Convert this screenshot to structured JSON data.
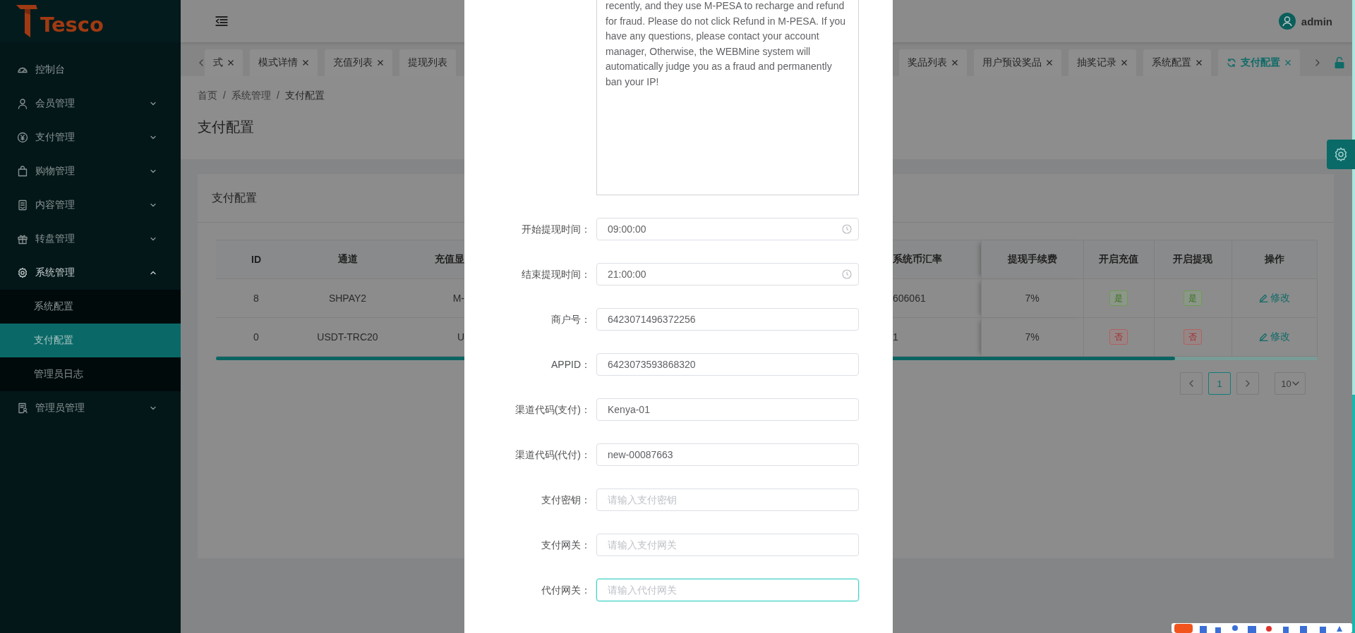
{
  "logo": {
    "text": "Tesco"
  },
  "sidebar": {
    "items": [
      {
        "label": "控制台",
        "kind": "link"
      },
      {
        "label": "会员管理",
        "kind": "menu",
        "expanded": false
      },
      {
        "label": "支付管理",
        "kind": "menu",
        "expanded": false
      },
      {
        "label": "购物管理",
        "kind": "menu",
        "expanded": false
      },
      {
        "label": "内容管理",
        "kind": "menu",
        "expanded": false
      },
      {
        "label": "转盘管理",
        "kind": "menu",
        "expanded": false
      },
      {
        "label": "系统管理",
        "kind": "menu",
        "expanded": true,
        "children": [
          {
            "label": "系统配置",
            "selected": false
          },
          {
            "label": "支付配置",
            "selected": true
          },
          {
            "label": "管理员日志",
            "selected": false
          }
        ]
      },
      {
        "label": "管理员管理",
        "kind": "menu",
        "expanded": false
      }
    ]
  },
  "header": {
    "user": "admin"
  },
  "tabs": {
    "left_items": [
      {
        "label": "式",
        "selected": false,
        "closable": true
      },
      {
        "label": "模式详情",
        "selected": false,
        "closable": true
      },
      {
        "label": "充值列表",
        "selected": false,
        "closable": true
      },
      {
        "label": "提现列表",
        "selected": false,
        "closable": false
      }
    ],
    "right_items": [
      {
        "label": "奖品列表",
        "selected": false,
        "closable": true
      },
      {
        "label": "用户预设奖品",
        "selected": false,
        "closable": true
      },
      {
        "label": "抽奖记录",
        "selected": false,
        "closable": true
      },
      {
        "label": "系统配置",
        "selected": false,
        "closable": true
      },
      {
        "label": "支付配置",
        "selected": true,
        "closable": true
      }
    ]
  },
  "breadcrumb": [
    {
      "label": "首页",
      "separator": "/"
    },
    {
      "label": "系统管理",
      "separator": "/"
    },
    {
      "label": "支付配置"
    }
  ],
  "page_title": "支付配置",
  "card": {
    "title": "支付配置",
    "table": {
      "columns": [
        "ID",
        "通道",
        "充值显",
        "系统币汇率",
        "提现手续费",
        "开启充值",
        "开启提现",
        "操作"
      ],
      "rows": [
        {
          "cells": [
            "8",
            "SHPAY2",
            "M-",
            "606061",
            "7%"
          ],
          "switches": [
            {
              "label": "是",
              "on": true
            },
            {
              "label": "是",
              "on": true
            }
          ],
          "action": "修改"
        },
        {
          "cells": [
            "0",
            "USDT-TRC20",
            "U",
            "1",
            "7%"
          ],
          "switches": [
            {
              "label": "否",
              "on": false
            },
            {
              "label": "否",
              "on": false
            }
          ],
          "action": "修改"
        }
      ]
    },
    "pagination": {
      "pages": [
        {
          "label": "1",
          "selected": true
        }
      ],
      "page_size": "10"
    }
  },
  "dialog": {
    "notice": "recently, and they use M-PESA to recharge and refund for fraud. Please do not click Refund in M-PESA. If you have any questions, please contact your account manager, Otherwise, the WEBMine system will automatically judge you as a fraud and permanently ban your IP!",
    "fields": [
      {
        "label": "开始提现时间：",
        "kind": "time",
        "value": "09:00:00",
        "focused": false
      },
      {
        "label": "结束提现时间：",
        "kind": "time",
        "value": "21:00:00",
        "focused": false
      },
      {
        "label": "商户号：",
        "kind": "text",
        "value": "6423071496372256",
        "focused": false
      },
      {
        "label": "APPID：",
        "kind": "text",
        "value": "6423073593868320",
        "focused": false
      },
      {
        "label": "渠道代码(支付)：",
        "kind": "text",
        "value": "Kenya-01",
        "focused": false
      },
      {
        "label": "渠道代码(代付)：",
        "kind": "text",
        "value": "new-00087663",
        "focused": false
      },
      {
        "label": "支付密钥：",
        "kind": "text",
        "placeholder": "请输入支付密钥",
        "focused": false
      },
      {
        "label": "支付网关：",
        "kind": "text",
        "placeholder": "请输入支付网关",
        "focused": false
      },
      {
        "label": "代付网关：",
        "kind": "text",
        "placeholder": "请输入代付网关",
        "focused": true
      }
    ]
  }
}
